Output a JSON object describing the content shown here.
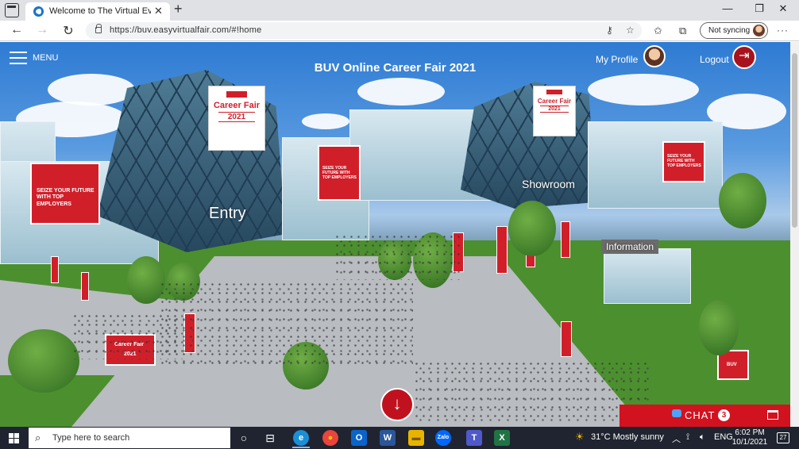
{
  "browser": {
    "tab_title": "Welcome to The Virtual Event. C",
    "tab_close": "✕",
    "new_tab": "+",
    "window_controls": [
      "—",
      "❐",
      "✕"
    ],
    "url": "https://buv.easyvirtualfair.com/#!home",
    "sync_label": "Not syncing",
    "more": "···",
    "back": "←",
    "forward": "→",
    "reload": "↻"
  },
  "page": {
    "menu_label": "MENU",
    "title": "BUV Online Career Fair 2021",
    "profile_label": "My Profile",
    "logout_label": "Logout",
    "logout_icon": "⇥",
    "scroll_down_icon": "↓",
    "scene_labels": {
      "entry": "Entry",
      "showroom": "Showroom",
      "information": "Information"
    },
    "banners": {
      "career_fair": "Career Fair",
      "year": "2021",
      "logo": "BUV",
      "tagline": "SEIZE YOUR FUTURE WITH TOP EMPLOYERS"
    },
    "chat": {
      "label": "CHAT",
      "count": "3"
    }
  },
  "taskbar": {
    "search_placeholder": "Type here to search",
    "weather": "31°C  Mostly sunny",
    "language": "ENG",
    "time": "6:02 PM",
    "date": "10/1/2021",
    "notification_count": "27",
    "apps": [
      {
        "name": "Cortana",
        "glyph": "○",
        "color": "transparent"
      },
      {
        "name": "Task View",
        "glyph": "⊟",
        "color": "transparent"
      },
      {
        "name": "Edge",
        "glyph": "e",
        "color": "#1a8fd6"
      },
      {
        "name": "Chrome",
        "glyph": "●",
        "color": "#e8453c"
      },
      {
        "name": "Outlook",
        "glyph": "O",
        "color": "#0a64c9"
      },
      {
        "name": "Word",
        "glyph": "W",
        "color": "#2b579a"
      },
      {
        "name": "File Explorer",
        "glyph": "▬",
        "color": "#e9b400"
      },
      {
        "name": "Zalo",
        "glyph": "Zalo",
        "color": "#0068ff"
      },
      {
        "name": "Teams",
        "glyph": "T",
        "color": "#5059c9"
      },
      {
        "name": "Excel",
        "glyph": "X",
        "color": "#217346"
      }
    ]
  }
}
